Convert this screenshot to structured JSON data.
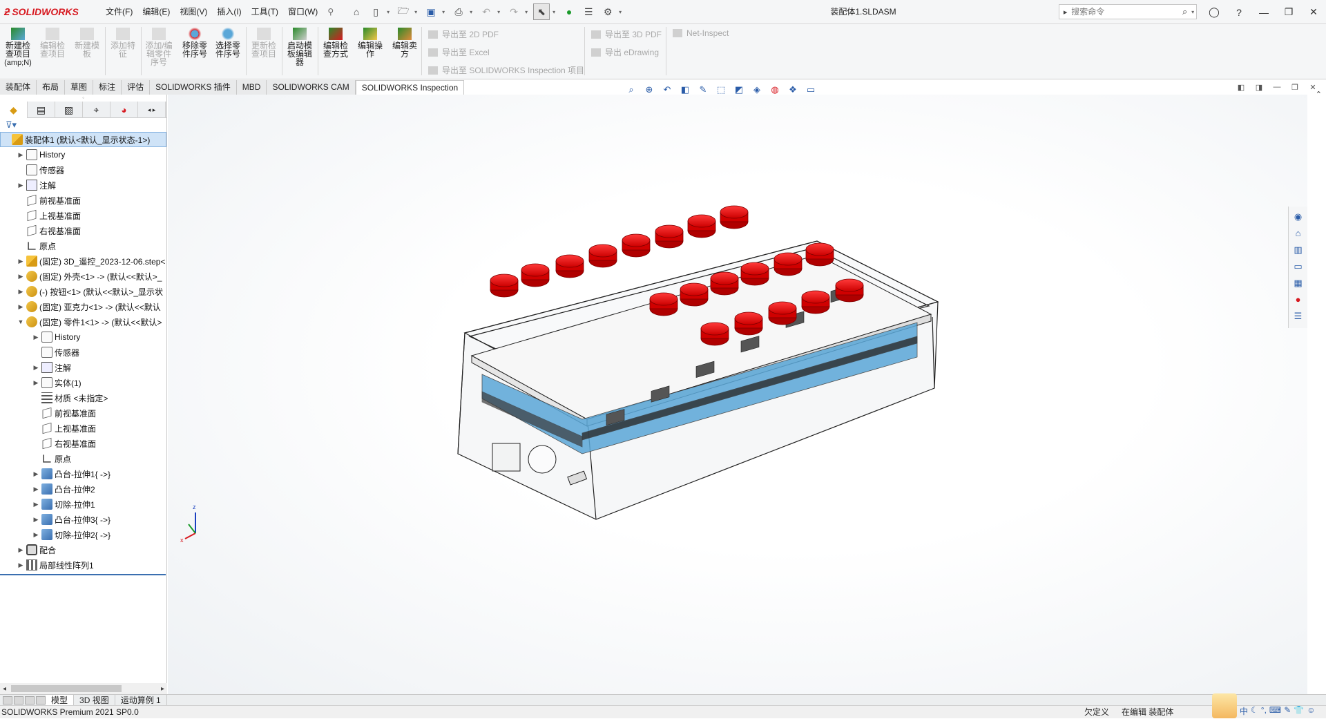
{
  "app": {
    "brand": "SOLIDWORKS",
    "document_title": "装配体1.SLDASM"
  },
  "menu": [
    "文件(F)",
    "编辑(E)",
    "视图(V)",
    "插入(I)",
    "工具(T)",
    "窗口(W)"
  ],
  "search": {
    "placeholder": "搜索命令"
  },
  "ribbon": {
    "buttons": [
      {
        "label": "新建检查项目",
        "sub": "(amp;N)",
        "enabled": true
      },
      {
        "label": "编辑检查项目",
        "enabled": false
      },
      {
        "label": "新建模板",
        "enabled": false
      },
      {
        "label": "添加特征",
        "enabled": false
      },
      {
        "label": "添加/编辑零件序号",
        "enabled": false
      },
      {
        "label": "移除零件序号",
        "enabled": true
      },
      {
        "label": "选择零件序号",
        "enabled": true
      },
      {
        "label": "更新检查项目",
        "enabled": false
      },
      {
        "label": "启动模板编辑器",
        "enabled": true
      },
      {
        "label": "编辑检查方式",
        "enabled": true
      },
      {
        "label": "编辑操作",
        "enabled": true
      },
      {
        "label": "编辑卖方",
        "enabled": true
      }
    ],
    "export": [
      "导出至 2D PDF",
      "导出至 Excel",
      "导出至 SOLIDWORKS Inspection 项目",
      "导出至 3D PDF",
      "导出 eDrawing",
      "Net-Inspect"
    ]
  },
  "tabs": [
    {
      "label": "装配体",
      "active": false
    },
    {
      "label": "布局",
      "active": false
    },
    {
      "label": "草图",
      "active": false
    },
    {
      "label": "标注",
      "active": false
    },
    {
      "label": "评估",
      "active": false
    },
    {
      "label": "SOLIDWORKS 插件",
      "active": false
    },
    {
      "label": "MBD",
      "active": false
    },
    {
      "label": "SOLIDWORKS CAM",
      "active": false
    },
    {
      "label": "SOLIDWORKS Inspection",
      "active": true
    }
  ],
  "tree": [
    {
      "label": "装配体1 (默认<默认_显示状态-1>)",
      "level": 0,
      "icon": "asm",
      "expander": "",
      "selected": true
    },
    {
      "label": "History",
      "level": 1,
      "icon": "folder",
      "expander": "▶"
    },
    {
      "label": "传感器",
      "level": 1,
      "icon": "folder",
      "expander": ""
    },
    {
      "label": "注解",
      "level": 1,
      "icon": "annot",
      "expander": "▶"
    },
    {
      "label": "前视基准面",
      "level": 1,
      "icon": "plane",
      "expander": ""
    },
    {
      "label": "上视基准面",
      "level": 1,
      "icon": "plane",
      "expander": ""
    },
    {
      "label": "右视基准面",
      "level": 1,
      "icon": "plane",
      "expander": ""
    },
    {
      "label": "原点",
      "level": 1,
      "icon": "origin",
      "expander": ""
    },
    {
      "label": "(固定) 3D_遥控_2023-12-06.step<",
      "level": 1,
      "icon": "asm",
      "expander": "▶"
    },
    {
      "label": "(固定) 外壳<1> -> (默认<<默认>_",
      "level": 1,
      "icon": "part",
      "expander": "▶"
    },
    {
      "label": "(-) 按钮<1> (默认<<默认>_显示状",
      "level": 1,
      "icon": "part",
      "expander": "▶"
    },
    {
      "label": "(固定) 亚克力<1> -> (默认<<默认",
      "level": 1,
      "icon": "part",
      "expander": "▶"
    },
    {
      "label": "(固定) 零件1<1> -> (默认<<默认>",
      "level": 1,
      "icon": "part",
      "expander": "▼"
    },
    {
      "label": "History",
      "level": 2,
      "icon": "folder",
      "expander": "▶"
    },
    {
      "label": "传感器",
      "level": 2,
      "icon": "folder",
      "expander": ""
    },
    {
      "label": "注解",
      "level": 2,
      "icon": "annot",
      "expander": "▶"
    },
    {
      "label": "实体(1)",
      "level": 2,
      "icon": "folder",
      "expander": "▶"
    },
    {
      "label": "材质 <未指定>",
      "level": 2,
      "icon": "mat",
      "expander": ""
    },
    {
      "label": "前视基准面",
      "level": 2,
      "icon": "plane",
      "expander": ""
    },
    {
      "label": "上视基准面",
      "level": 2,
      "icon": "plane",
      "expander": ""
    },
    {
      "label": "右视基准面",
      "level": 2,
      "icon": "plane",
      "expander": ""
    },
    {
      "label": "原点",
      "level": 2,
      "icon": "origin",
      "expander": ""
    },
    {
      "label": "凸台-拉伸1{ ->}",
      "level": 2,
      "icon": "feat",
      "expander": "▶"
    },
    {
      "label": "凸台-拉伸2",
      "level": 2,
      "icon": "feat",
      "expander": "▶"
    },
    {
      "label": "切除-拉伸1",
      "level": 2,
      "icon": "feat",
      "expander": "▶"
    },
    {
      "label": "凸台-拉伸3{ ->}",
      "level": 2,
      "icon": "feat",
      "expander": "▶"
    },
    {
      "label": "切除-拉伸2{ ->}",
      "level": 2,
      "icon": "feat",
      "expander": "▶"
    },
    {
      "label": "配合",
      "level": 1,
      "icon": "mate",
      "expander": "▶"
    },
    {
      "label": "局部线性阵列1",
      "level": 1,
      "icon": "pattern",
      "expander": "▶"
    }
  ],
  "bottom_tabs": [
    {
      "label": "模型",
      "active": true
    },
    {
      "label": "3D 视图",
      "active": false
    },
    {
      "label": "运动算例 1",
      "active": false
    }
  ],
  "status": {
    "left": "SOLIDWORKS Premium 2021 SP0.0",
    "define": "欠定义",
    "editing": "在编辑 装配体"
  },
  "ime": {
    "lang": "中"
  },
  "colors": {
    "accent": "#d71920",
    "selection": "#cfe3f7",
    "button_red": "#e01010",
    "pcb_blue": "#5aa7d8"
  }
}
